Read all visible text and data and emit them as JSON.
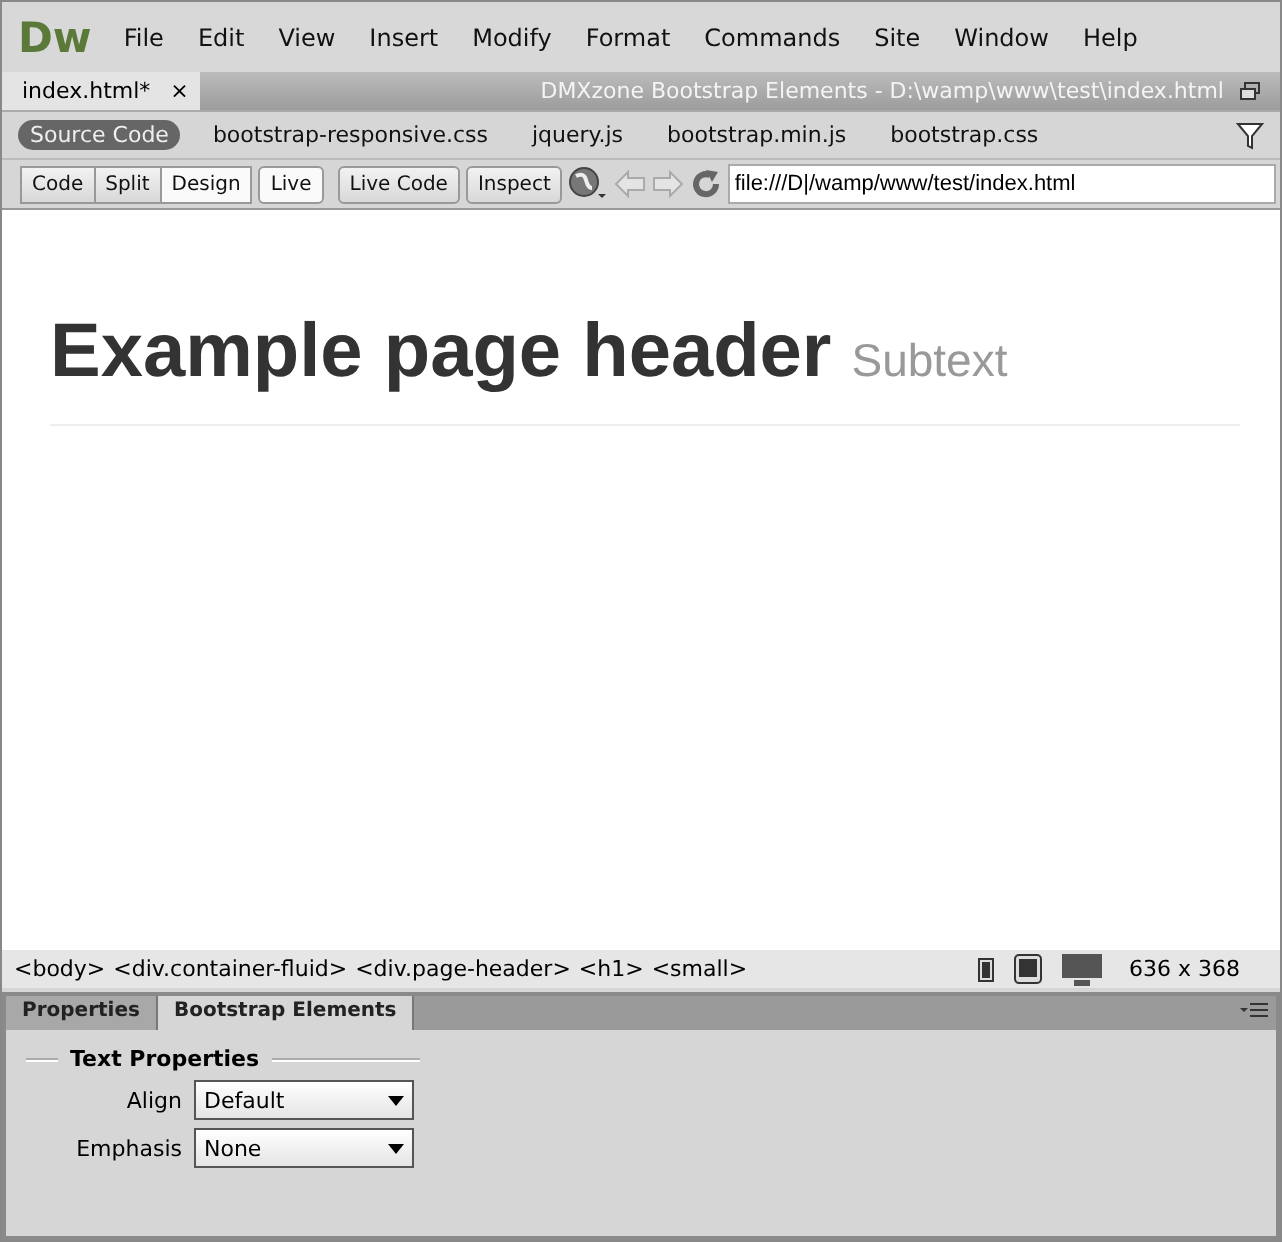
{
  "app": {
    "logo": "Dw"
  },
  "menu": [
    "File",
    "Edit",
    "View",
    "Insert",
    "Modify",
    "Format",
    "Commands",
    "Site",
    "Window",
    "Help"
  ],
  "document_tab": {
    "label": "index.html*",
    "close": "×",
    "path": "DMXzone Bootstrap Elements - D:\\wamp\\www\\test\\index.html"
  },
  "related_files": [
    {
      "label": "Source Code",
      "selected": true
    },
    {
      "label": "bootstrap-responsive.css",
      "selected": false
    },
    {
      "label": "jquery.js",
      "selected": false
    },
    {
      "label": "bootstrap.min.js",
      "selected": false
    },
    {
      "label": "bootstrap.css",
      "selected": false
    }
  ],
  "view_buttons": [
    {
      "label": "Code",
      "selected": false
    },
    {
      "label": "Split",
      "selected": false
    },
    {
      "label": "Design",
      "selected": true
    }
  ],
  "toolbar_buttons": [
    "Live",
    "Live Code",
    "Inspect"
  ],
  "address": "file:///D|/wamp/www/test/index.html",
  "page": {
    "heading": "Example page header",
    "subtext": "Subtext"
  },
  "tag_selector": [
    "<body>",
    "<div.container-fluid>",
    "<div.page-header>",
    "<h1>",
    "<small>"
  ],
  "window_size": "636 x 368",
  "panel_tabs": [
    {
      "label": "Properties",
      "selected": false
    },
    {
      "label": "Bootstrap Elements",
      "selected": true
    }
  ],
  "panel": {
    "section": "Text Properties",
    "fields": [
      {
        "label": "Align",
        "value": "Default"
      },
      {
        "label": "Emphasis",
        "value": "None"
      }
    ]
  }
}
